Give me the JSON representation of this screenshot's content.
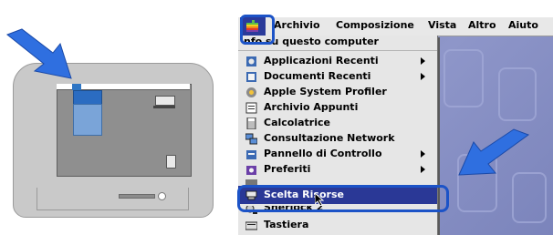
{
  "menubar": {
    "items": [
      "Archivio",
      "Composizione",
      "Vista",
      "Altro",
      "Aiuto"
    ]
  },
  "apple_menu": {
    "items": [
      {
        "label": "nfo su questo computer",
        "icon": "none",
        "submenu": false
      },
      {
        "label": "Applicazioni Recenti",
        "icon": "recent-apps-icon",
        "submenu": true
      },
      {
        "label": "Documenti Recenti",
        "icon": "recent-docs-icon",
        "submenu": true
      },
      {
        "label": "Apple System Profiler",
        "icon": "profiler-icon",
        "submenu": false
      },
      {
        "label": "Archivio Appunti",
        "icon": "clipboard-icon",
        "submenu": false
      },
      {
        "label": "Calcolatrice",
        "icon": "calculator-icon",
        "submenu": false
      },
      {
        "label": "Consultazione Network",
        "icon": "network-icon",
        "submenu": false
      },
      {
        "label": "Pannello di Controllo",
        "icon": "control-panel-icon",
        "submenu": true
      },
      {
        "label": "Preferiti",
        "icon": "favorites-icon",
        "submenu": true
      },
      {
        "label": "Scelta Risorse",
        "icon": "chooser-icon",
        "submenu": false,
        "selected": true
      },
      {
        "label": "Sherlock 2",
        "icon": "sherlock-icon",
        "submenu": false
      },
      {
        "label": "Tastiera",
        "icon": "keyboard-icon",
        "submenu": false
      }
    ]
  },
  "colors": {
    "highlight_border": "#1c53c7",
    "selection": "#2a3896",
    "desktop": "#8089bf"
  }
}
